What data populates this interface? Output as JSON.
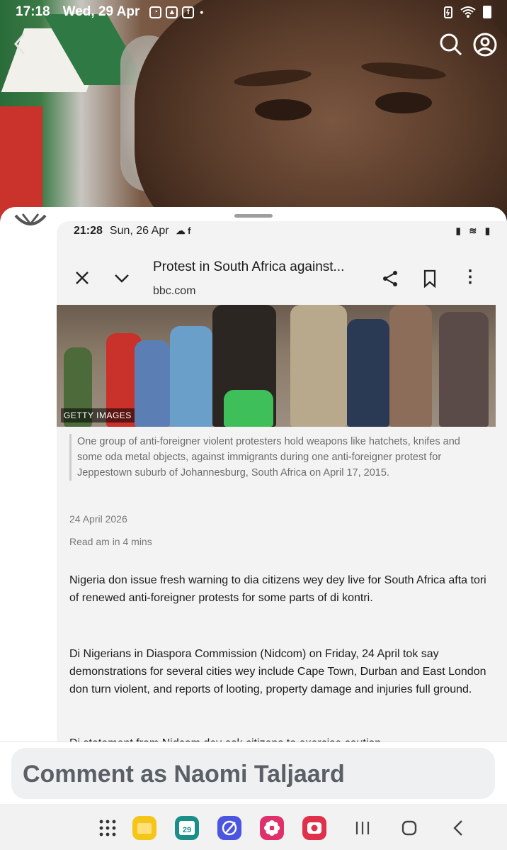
{
  "status_bar": {
    "time": "17:18",
    "date": "Wed, 29 Apr",
    "notif_icons": [
      "whatsapp-icon",
      "gallery-icon",
      "facebook-icon"
    ],
    "dot": "•",
    "right_icons": [
      "battery-saver-icon",
      "wifi-icon",
      "battery-icon"
    ]
  },
  "header": {
    "back_icon": "chevron-left-icon",
    "search_icon": "search-icon",
    "account_icon": "account-icon"
  },
  "nested_screenshot": {
    "status": {
      "time": "21:28",
      "date": "Sun, 26 Apr",
      "icons": "☁ f",
      "right": "▮ ≋ ▮"
    },
    "toolbar": {
      "title": "Protest in South Africa against...",
      "domain": "bbc.com",
      "close_icon": "close-icon",
      "chevron_icon": "chevron-down-icon",
      "share_icon": "share-icon",
      "bookmark_icon": "bookmark-icon",
      "more_icon": "more-vertical-icon"
    },
    "photo_credit": "GETTY IMAGES",
    "caption": "One group of anti-foreigner violent protesters hold weapons like hatchets, knifes and some oda metal objects, against immigrants during one anti-foreigner protest for Jeppestown suburb of Johannesburg, South Africa on April 17, 2015.",
    "pub_date": "24 April 2026",
    "read_time": "Read am in 4 mins",
    "paragraphs": [
      "Nigeria don issue fresh warning to dia citizens wey dey live for South Africa afta tori of renewed anti-foreigner protests for some parts of di kontri.",
      "Di Nigerians in Diaspora Commission (Nidcom) on Friday, 24 April tok say demonstrations for several cities wey include Cape Town, Durban and East London don turn violent, and reports of looting, property damage and injuries full ground.",
      "Di statement from Nidcom dey ask citizens to exercise caution."
    ]
  },
  "comment": {
    "placeholder": "Comment as Naomi Taljaard"
  },
  "nav_bar": {
    "calendar_day": "29",
    "items": [
      "apps-grid-icon",
      "files-icon",
      "calendar-icon",
      "browser-icon",
      "flower-app-icon",
      "camera-app-icon",
      "recent-apps-icon",
      "home-icon",
      "back-icon"
    ]
  },
  "colors": {
    "comment_bg": "#eef0f2",
    "comment_text": "#5b6066",
    "nav_bg": "#f2f2f2",
    "files_yellow": "#f5c518",
    "calendar_teal": "#1a8f8a",
    "browser_blue": "#4a55e0",
    "flower_pink": "#e0306a",
    "camera_red": "#e0304a"
  }
}
